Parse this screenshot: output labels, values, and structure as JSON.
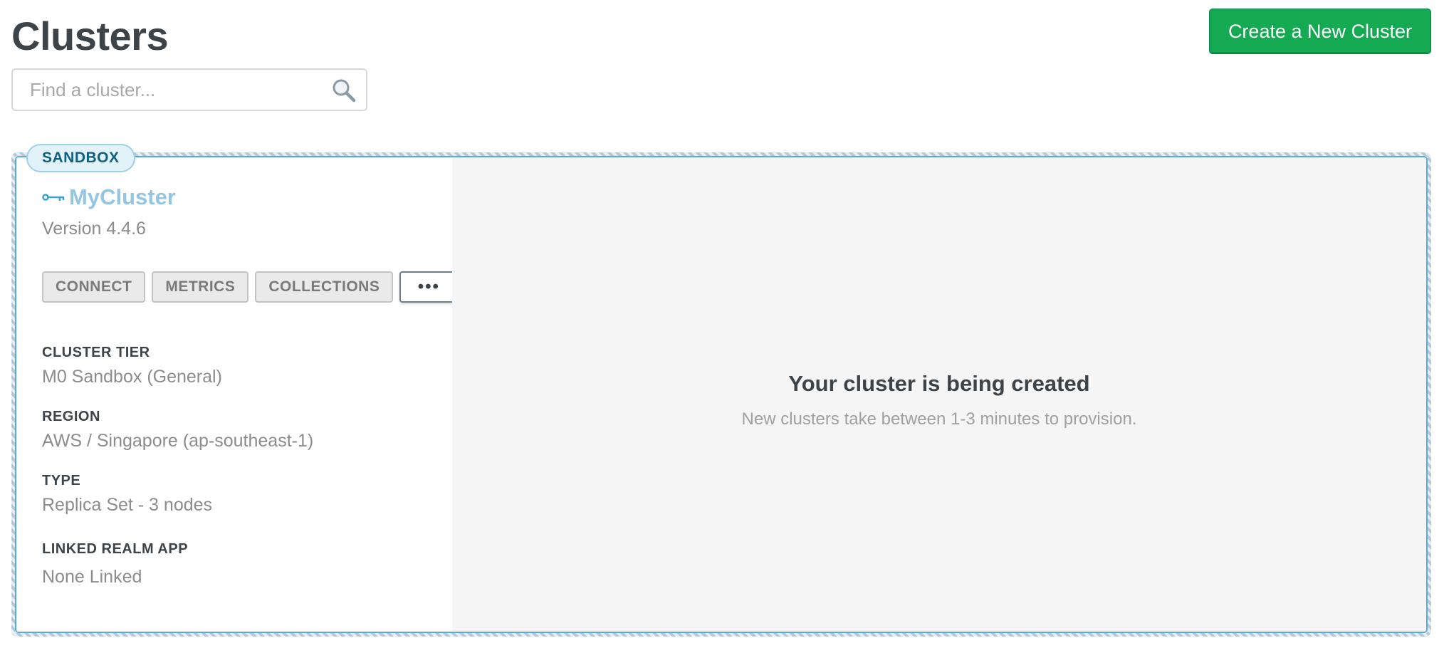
{
  "header": {
    "title": "Clusters",
    "create_button_label": "Create a New Cluster"
  },
  "search": {
    "placeholder": "Find a cluster...",
    "value": "",
    "icon": "search-icon"
  },
  "cluster": {
    "badge": "SANDBOX",
    "name": "MyCluster",
    "name_icon": "key-icon",
    "version": "Version 4.4.6",
    "actions": {
      "connect": "CONNECT",
      "metrics": "METRICS",
      "collections": "COLLECTIONS",
      "more": "•••"
    },
    "details": [
      {
        "label": "CLUSTER TIER",
        "value": "M0 Sandbox (General)"
      },
      {
        "label": "REGION",
        "value": "AWS / Singapore (ap-southeast-1)"
      },
      {
        "label": "TYPE",
        "value": "Replica Set - 3 nodes"
      },
      {
        "label": "LINKED REALM APP",
        "value": "None Linked"
      }
    ],
    "status": {
      "title": "Your cluster is being created",
      "subtitle": "New clusters take between 1-3 minutes to provision."
    }
  },
  "colors": {
    "primary_button": "#13aa52",
    "title_text": "#3d4449",
    "cluster_name": "#93c6e3",
    "badge_bg": "#e1f2f8",
    "badge_text": "#0f5f80",
    "card_border": "#5aa9d6",
    "status_panel_bg": "#f4f5f4"
  }
}
